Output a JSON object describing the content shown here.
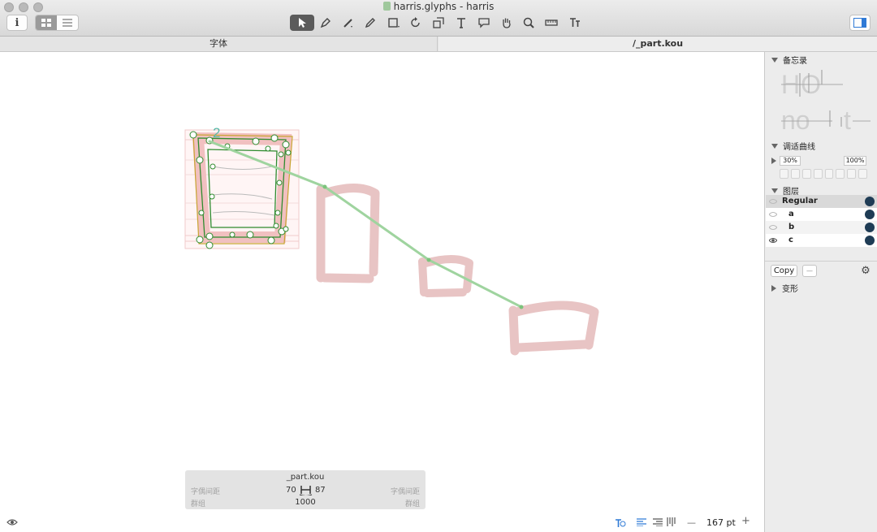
{
  "window": {
    "title": "harris.glyphs - harris",
    "tabs": [
      {
        "label": "字体"
      },
      {
        "label": "/_part.kou"
      }
    ]
  },
  "toolbar": {
    "info_icon": "info-icon",
    "tools": [
      "select-tool-icon",
      "pen-tool-icon",
      "draw-tool-icon",
      "pencil-icon",
      "rectangle-tool-icon",
      "rotate-icon",
      "scale-icon",
      "text-tool-icon",
      "annotation-icon",
      "hand-icon",
      "zoom-icon",
      "measure-icon",
      "component-text-icon"
    ]
  },
  "glyph": {
    "marker_label": "2"
  },
  "info_panel": {
    "glyph_name": "_part.kou",
    "kerning_left_label": "字偶间距",
    "kerning_right_label": "字偶间距",
    "lsb": "70",
    "rsb": "87",
    "group_left_label": "群组",
    "group_right_label": "群组",
    "width": "1000"
  },
  "statusbar": {
    "zoom": "167 pt",
    "minus": "—",
    "plus": "+"
  },
  "sidebar": {
    "memo": {
      "title": "备忘录",
      "samples": [
        "HO",
        "no",
        "t"
      ]
    },
    "curves": {
      "title": "调适曲线",
      "left_value": "30%",
      "right_value": "100%"
    },
    "layers": {
      "title": "图层",
      "items": [
        {
          "name": "Regular"
        },
        {
          "name": "a"
        },
        {
          "name": "b"
        },
        {
          "name": "c"
        }
      ]
    },
    "copy_label": "Copy",
    "dash_label": "—",
    "transform_title": "变形"
  },
  "colors": {
    "layer_dot": "#1f3c55",
    "ghost_glyph": "#e8c4c4",
    "outline_green": "#2e8b2e",
    "selection": "#f1c0c0"
  }
}
